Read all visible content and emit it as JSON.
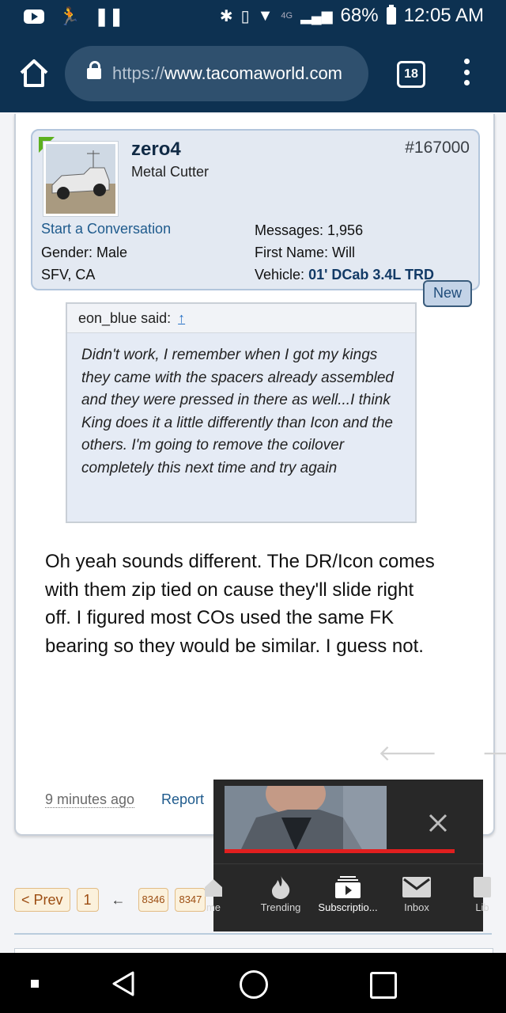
{
  "status_bar": {
    "battery": "68%",
    "time": "12:05 AM",
    "network": "4G"
  },
  "browser": {
    "url_scheme": "https://",
    "url_host": "www.tacomaworld.com",
    "tab_count": "18"
  },
  "post": {
    "username": "zero4",
    "user_title": "Metal Cutter",
    "post_number": "#167000",
    "start_conversation": "Start a Conversation",
    "gender": "Gender:  Male",
    "location": "SFV, CA",
    "messages": "Messages:  1,956",
    "first_name": "First Name:  Will",
    "vehicle_label": "Vehicle:",
    "vehicle_value": "01' DCab 3.4L TRD",
    "new_badge": "New",
    "quote_author": "eon_blue said:",
    "quote_arrow": "↑",
    "quote_text": "Didn't work, I remember when I got my kings they came with the spacers already assembled and they were pressed in there as well...I think King does it a little differently than Icon and the others. I'm going to remove the coilover completely this next time and try again",
    "body": "Oh yeah sounds different. The DR/Icon comes with them zip tied on cause they'll slide right off. I figured most COs used the same FK bearing so they would be similar. I guess not.",
    "timestamp": "9 minutes ago",
    "report": "Report"
  },
  "pagination": {
    "prev": "< Prev",
    "first": "1",
    "ellipsis": "←",
    "p1": "8346",
    "p2": "8347"
  },
  "mini_player": {
    "nav": [
      {
        "label": "me",
        "icon": "home-icon"
      },
      {
        "label": "Trending",
        "icon": "flame-icon"
      },
      {
        "label": "Subscriptio...",
        "icon": "subscriptions-icon"
      },
      {
        "label": "Inbox",
        "icon": "mail-icon"
      },
      {
        "label": "Lib",
        "icon": "library-icon"
      }
    ]
  }
}
